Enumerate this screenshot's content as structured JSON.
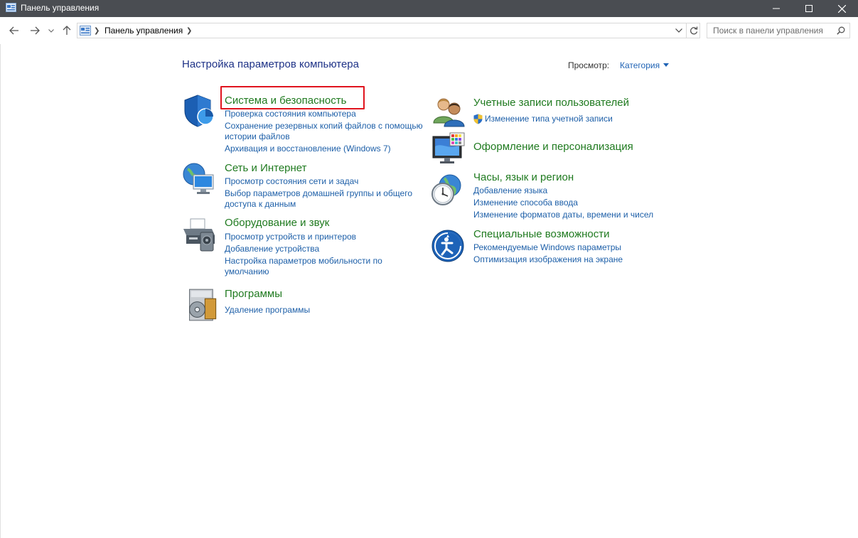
{
  "window": {
    "title": "Панель управления"
  },
  "address": {
    "path": "Панель управления"
  },
  "search": {
    "placeholder": "Поиск в панели управления"
  },
  "main": {
    "heading": "Настройка параметров компьютера",
    "view_label": "Просмотр:",
    "view_value": "Категория"
  },
  "categories": [
    {
      "title": "Система и безопасность",
      "links": [
        "Проверка состояния компьютера",
        "Сохранение резервных копий файлов с помощью",
        "истории файлов",
        "Архивация и восстановление (Windows 7)"
      ]
    },
    {
      "title": "Сеть и Интернет",
      "links": [
        "Просмотр состояния сети и задач",
        "Выбор параметров домашней группы и общего",
        "доступа к данным"
      ]
    },
    {
      "title": "Оборудование и звук",
      "links": [
        "Просмотр устройств и принтеров",
        "Добавление устройства",
        "Настройка параметров мобильности по",
        "умолчанию"
      ]
    },
    {
      "title": "Программы",
      "links": [
        "Удаление программы"
      ]
    },
    {
      "title": "Учетные записи пользователей",
      "links": [
        "Изменение типа учетной записи"
      ]
    },
    {
      "title": "Оформление и персонализация",
      "links": []
    },
    {
      "title": "Часы, язык и регион",
      "links": [
        "Добавление языка",
        "Изменение способа ввода",
        "Изменение форматов даты, времени и чисел"
      ]
    },
    {
      "title": "Специальные возможности",
      "links": [
        "Рекомендуемые Windows параметры",
        "Оптимизация изображения на экране"
      ]
    }
  ],
  "colors": {
    "titlebar": "#4a4d52",
    "heading": "#1e3287",
    "category_title": "#1f7a1f",
    "link": "#1d5fa8",
    "highlight": "#e0141e"
  },
  "icons": [
    "control-panel-icon",
    "back-arrow-icon",
    "forward-arrow-icon",
    "chevron-down-icon",
    "up-arrow-icon",
    "refresh-icon",
    "search-icon",
    "shield-icon",
    "network-globe-icon",
    "printer-icon",
    "programs-disk-icon",
    "users-icon",
    "uac-shield-icon",
    "monitor-palette-icon",
    "clock-globe-icon",
    "accessibility-icon"
  ]
}
